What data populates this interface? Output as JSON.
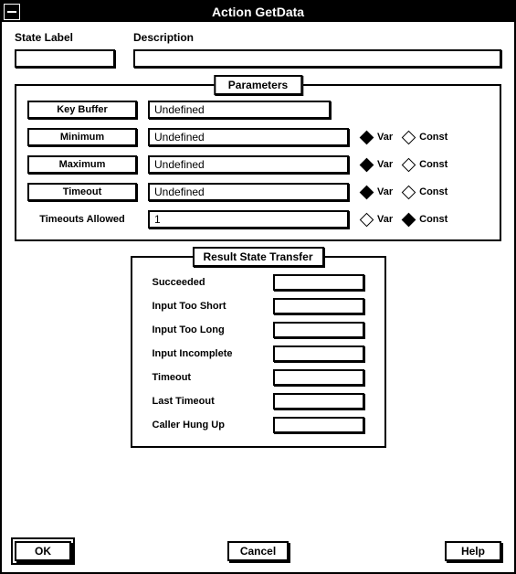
{
  "window": {
    "title": "Action GetData"
  },
  "top": {
    "state_label": "State Label",
    "description_label": "Description",
    "state_value": "",
    "description_value": ""
  },
  "parameters": {
    "legend": "Parameters",
    "rows": [
      {
        "label": "Key Buffer",
        "value": "Undefined",
        "has_radio": false
      },
      {
        "label": "Minimum",
        "value": "Undefined",
        "has_radio": true,
        "selected": "Var"
      },
      {
        "label": "Maximum",
        "value": "Undefined",
        "has_radio": true,
        "selected": "Var"
      },
      {
        "label": "Timeout",
        "value": "Undefined",
        "has_radio": true,
        "selected": "Var"
      },
      {
        "label": "Timeouts Allowed",
        "value": "1",
        "has_radio": true,
        "selected": "Const",
        "plain_label": true
      }
    ],
    "radio_labels": {
      "var": "Var",
      "const": "Const"
    }
  },
  "result": {
    "legend": "Result State Transfer",
    "rows": [
      {
        "label": "Succeeded",
        "value": ""
      },
      {
        "label": "Input Too Short",
        "value": ""
      },
      {
        "label": "Input Too Long",
        "value": ""
      },
      {
        "label": "Input Incomplete",
        "value": ""
      },
      {
        "label": "Timeout",
        "value": ""
      },
      {
        "label": "Last Timeout",
        "value": ""
      },
      {
        "label": "Caller Hung Up",
        "value": ""
      }
    ]
  },
  "buttons": {
    "ok": "OK",
    "cancel": "Cancel",
    "help": "Help"
  }
}
